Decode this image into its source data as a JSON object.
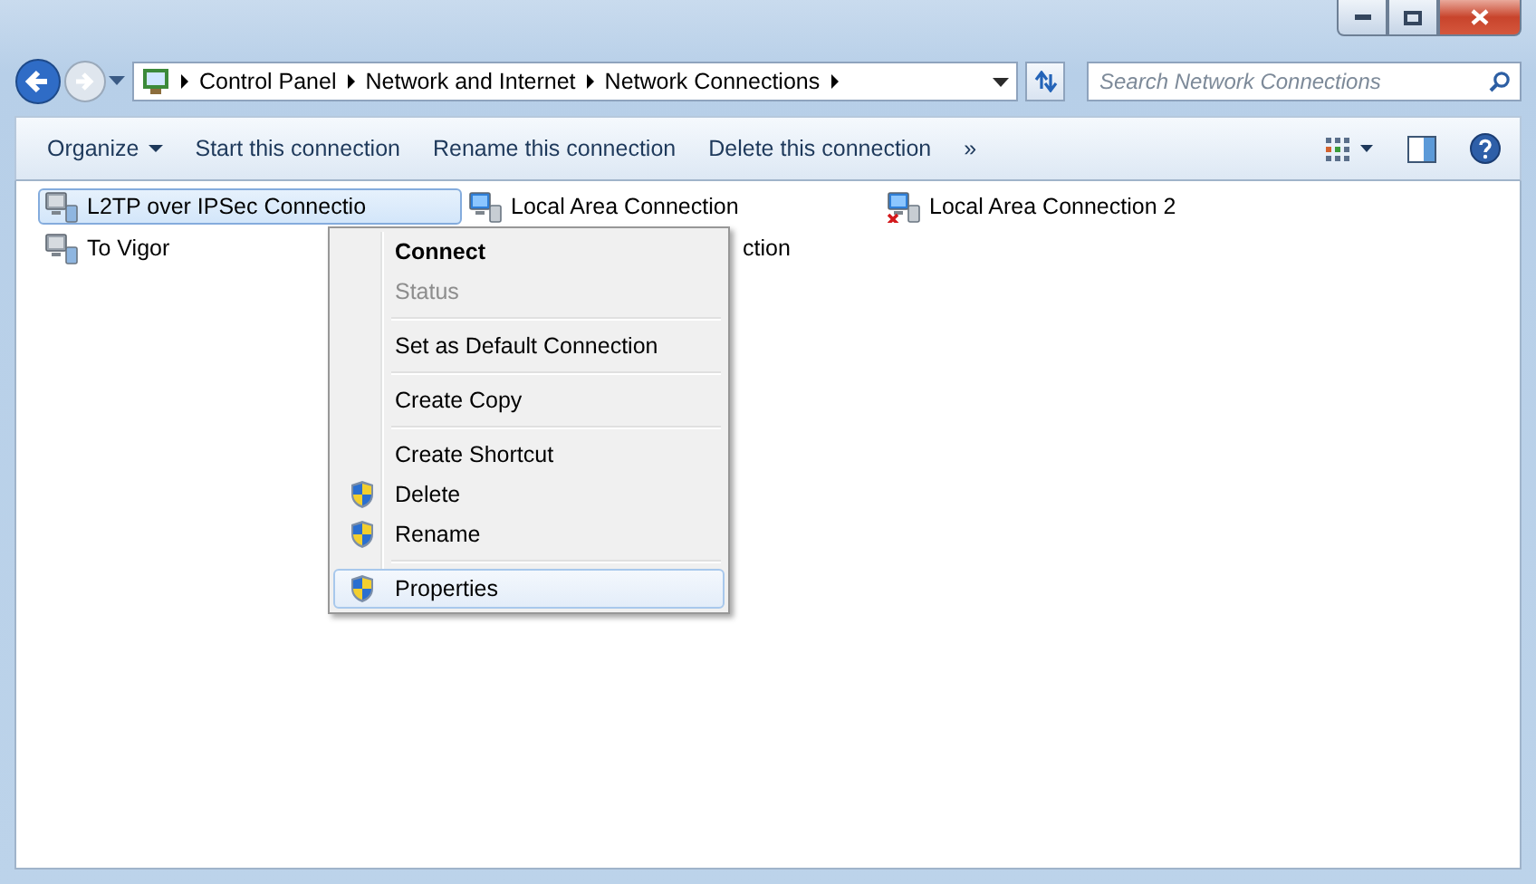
{
  "address": {
    "crumbs": [
      "Control Panel",
      "Network and Internet",
      "Network Connections"
    ],
    "search": {
      "placeholder": "Search Network Connections"
    }
  },
  "toolbar": {
    "items": [
      {
        "label": "Organize",
        "kind": "dropdown"
      },
      {
        "label": "Start this connection",
        "kind": "plain"
      },
      {
        "label": "Rename this connection",
        "kind": "plain"
      },
      {
        "label": "Delete this connection",
        "kind": "plain"
      },
      {
        "label": "»",
        "kind": "plain"
      }
    ]
  },
  "connections": [
    {
      "name": "L2TP over IPSec Connectio",
      "kind": "vpn",
      "selected": true
    },
    {
      "name": "Local Area Connection",
      "kind": "lan",
      "selected": false
    },
    {
      "name": "Local Area Connection 2",
      "kind": "lan-disconnected",
      "selected": false
    },
    {
      "name": "To Vigor",
      "kind": "vpn",
      "selected": false
    },
    {
      "name": "ction",
      "kind": "covered",
      "selected": false
    }
  ],
  "context_menu": {
    "items": [
      {
        "label": "Connect",
        "kind": "item",
        "bold": true,
        "disabled": false,
        "shield": false,
        "selected": false
      },
      {
        "label": "Status",
        "kind": "item",
        "bold": false,
        "disabled": true,
        "shield": false,
        "selected": false
      },
      {
        "kind": "separator"
      },
      {
        "label": "Set as Default Connection",
        "kind": "item",
        "bold": false,
        "disabled": false,
        "shield": false,
        "selected": false
      },
      {
        "kind": "separator"
      },
      {
        "label": "Create Copy",
        "kind": "item",
        "bold": false,
        "disabled": false,
        "shield": false,
        "selected": false
      },
      {
        "kind": "separator"
      },
      {
        "label": "Create Shortcut",
        "kind": "item",
        "bold": false,
        "disabled": false,
        "shield": false,
        "selected": false
      },
      {
        "label": "Delete",
        "kind": "item",
        "bold": false,
        "disabled": false,
        "shield": true,
        "selected": false
      },
      {
        "label": "Rename",
        "kind": "item",
        "bold": false,
        "disabled": false,
        "shield": true,
        "selected": false
      },
      {
        "kind": "separator"
      },
      {
        "label": "Properties",
        "kind": "item",
        "bold": false,
        "disabled": false,
        "shield": true,
        "selected": true
      }
    ]
  }
}
